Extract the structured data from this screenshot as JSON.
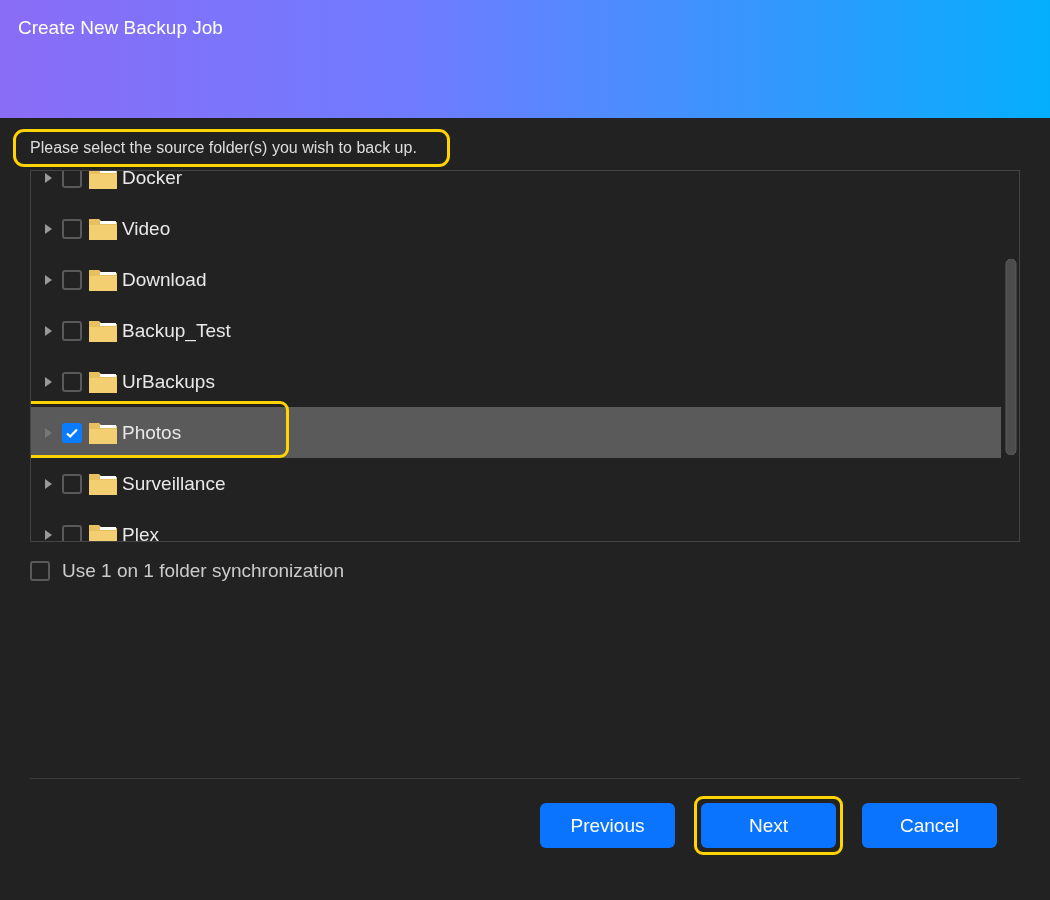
{
  "window": {
    "title": "Create New Backup Job"
  },
  "instruction": {
    "text": "Please select the source folder(s) you wish to back up.",
    "highlighted": true
  },
  "folders": [
    {
      "name": "Docker",
      "checked": false,
      "selected": false,
      "highlighted": false
    },
    {
      "name": "Video",
      "checked": false,
      "selected": false,
      "highlighted": false
    },
    {
      "name": "Download",
      "checked": false,
      "selected": false,
      "highlighted": false
    },
    {
      "name": "Backup_Test",
      "checked": false,
      "selected": false,
      "highlighted": false
    },
    {
      "name": "UrBackups",
      "checked": false,
      "selected": false,
      "highlighted": false
    },
    {
      "name": "Photos",
      "checked": true,
      "selected": true,
      "highlighted": true
    },
    {
      "name": "Surveillance",
      "checked": false,
      "selected": false,
      "highlighted": false
    },
    {
      "name": "Plex",
      "checked": false,
      "selected": false,
      "highlighted": false
    }
  ],
  "sync_option": {
    "label": "Use 1 on 1 folder synchronization",
    "checked": false
  },
  "buttons": [
    {
      "label": "Previous",
      "highlighted": false
    },
    {
      "label": "Next",
      "highlighted": true
    },
    {
      "label": "Cancel",
      "highlighted": false
    }
  ]
}
